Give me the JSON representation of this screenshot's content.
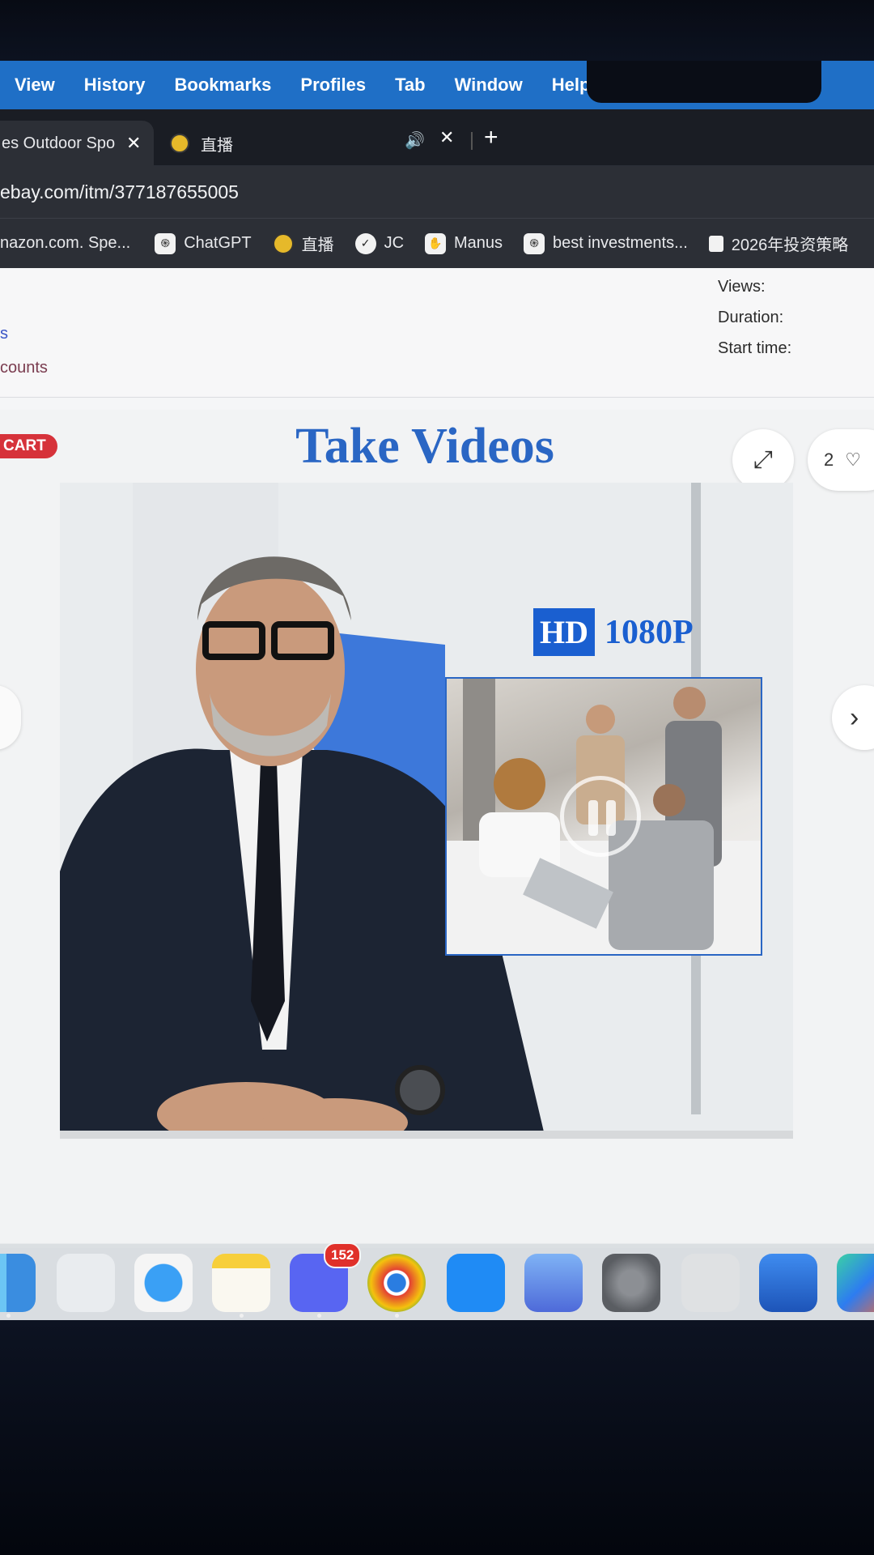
{
  "menubar": {
    "items": [
      "View",
      "History",
      "Bookmarks",
      "Profiles",
      "Tab",
      "Window",
      "Help"
    ]
  },
  "tabs": {
    "active_title": "es Outdoor Spo",
    "second_title": "直播"
  },
  "address": {
    "url": "ebay.com/itm/377187655005"
  },
  "bookmarks": [
    {
      "label": "nazon.com. Spe...",
      "icon": "amazon-icon"
    },
    {
      "label": "ChatGPT",
      "icon": "openai-icon"
    },
    {
      "label": "直播",
      "icon": "bee-icon"
    },
    {
      "label": "JC",
      "icon": "swoosh-icon"
    },
    {
      "label": "Manus",
      "icon": "manus-icon"
    },
    {
      "label": "best investments...",
      "icon": "openai-icon"
    },
    {
      "label": "2026年投资策略",
      "icon": "doc-icon"
    }
  ],
  "page": {
    "link_partial_1": "s",
    "link_partial_2": "counts",
    "meta": {
      "views": "Views:",
      "duration": "Duration:",
      "start_time": "Start time:"
    }
  },
  "gallery": {
    "cart_badge": "CART",
    "headline": "Take Videos",
    "hd_label": "HD",
    "resolution": "1080P",
    "watch_count": "2"
  },
  "dock": {
    "apps": [
      "Finder",
      "Launchpad",
      "Safari",
      "Notes",
      "Discord",
      "Chrome",
      "App Store",
      "iPhone Mirroring",
      "System Settings",
      "Calculator",
      "Word",
      "Copilot"
    ],
    "discord_badge": "152"
  },
  "colors": {
    "menubar": "#1f6fc6",
    "headline": "#2a66c4",
    "cart": "#d6323a"
  }
}
